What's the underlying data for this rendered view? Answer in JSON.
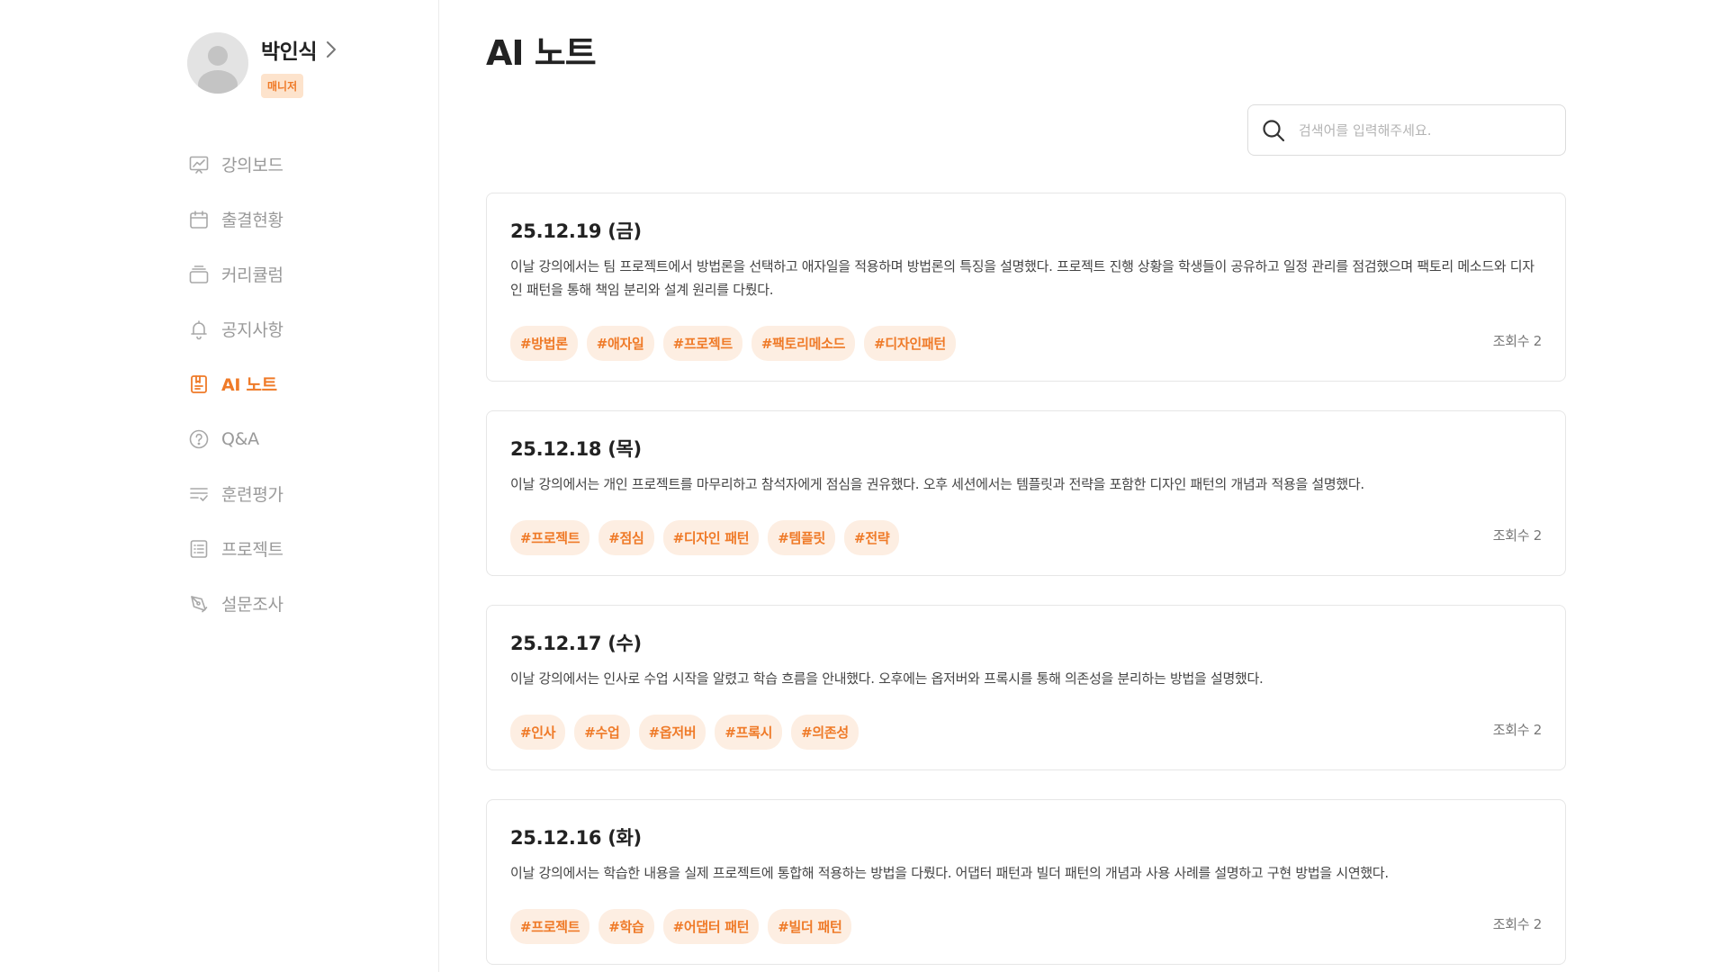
{
  "profile": {
    "name": "박인식",
    "role": "매니저"
  },
  "colors": {
    "accent": "#ef7a28",
    "tag_bg": "#fdeee2",
    "badge_bg": "#fde3cc",
    "muted_text": "#9a9a9a"
  },
  "sidebar": {
    "items": [
      {
        "label": "강의보드",
        "icon": "chart-board-icon",
        "active": false
      },
      {
        "label": "출결현황",
        "icon": "calendar-icon",
        "active": false
      },
      {
        "label": "커리큘럼",
        "icon": "layers-icon",
        "active": false
      },
      {
        "label": "공지사항",
        "icon": "bell-icon",
        "active": false
      },
      {
        "label": "AI 노트",
        "icon": "ai-note-icon",
        "active": true
      },
      {
        "label": "Q&A",
        "icon": "question-circle-icon",
        "active": false
      },
      {
        "label": "훈련평가",
        "icon": "list-check-icon",
        "active": false
      },
      {
        "label": "프로젝트",
        "icon": "document-list-icon",
        "active": false
      },
      {
        "label": "설문조사",
        "icon": "pen-survey-icon",
        "active": false
      }
    ]
  },
  "main": {
    "title": "AI 노트",
    "search": {
      "placeholder": "검색어를 입력해주세요.",
      "value": ""
    },
    "notes": [
      {
        "date": "25.12.19 (금)",
        "summary": "이날 강의에서는 팀 프로젝트에서 방법론을 선택하고 애자일을 적용하며 방법론의 특징을 설명했다. 프로젝트 진행 상황을 학생들이 공유하고 일정 관리를 점검했으며 팩토리 메소드와 디자인 패턴을 통해 책임 분리와 설계 원리를 다뤘다.",
        "tags": [
          "#방법론",
          "#애자일",
          "#프로젝트",
          "#팩토리메소드",
          "#디자인패턴"
        ],
        "views": "조회수 2"
      },
      {
        "date": "25.12.18 (목)",
        "summary": "이날 강의에서는 개인 프로젝트를 마무리하고 참석자에게 점심을 권유했다. 오후 세션에서는 템플릿과 전략을 포함한 디자인 패턴의 개념과 적용을 설명했다.",
        "tags": [
          "#프로젝트",
          "#점심",
          "#디자인 패턴",
          "#템플릿",
          "#전략"
        ],
        "views": "조회수 2"
      },
      {
        "date": "25.12.17 (수)",
        "summary": "이날 강의에서는 인사로 수업 시작을 알렸고 학습 흐름을 안내했다. 오후에는 옵저버와 프록시를 통해 의존성을 분리하는 방법을 설명했다.",
        "tags": [
          "#인사",
          "#수업",
          "#옵저버",
          "#프록시",
          "#의존성"
        ],
        "views": "조회수 2"
      },
      {
        "date": "25.12.16 (화)",
        "summary": "이날 강의에서는 학습한 내용을 실제 프로젝트에 통합해 적용하는 방법을 다뤘다. 어댑터 패턴과 빌더 패턴의 개념과 사용 사례를 설명하고 구현 방법을 시연했다.",
        "tags": [
          "#프로젝트",
          "#학습",
          "#어댑터 패턴",
          "#빌더 패턴"
        ],
        "views": "조회수 2"
      }
    ]
  }
}
